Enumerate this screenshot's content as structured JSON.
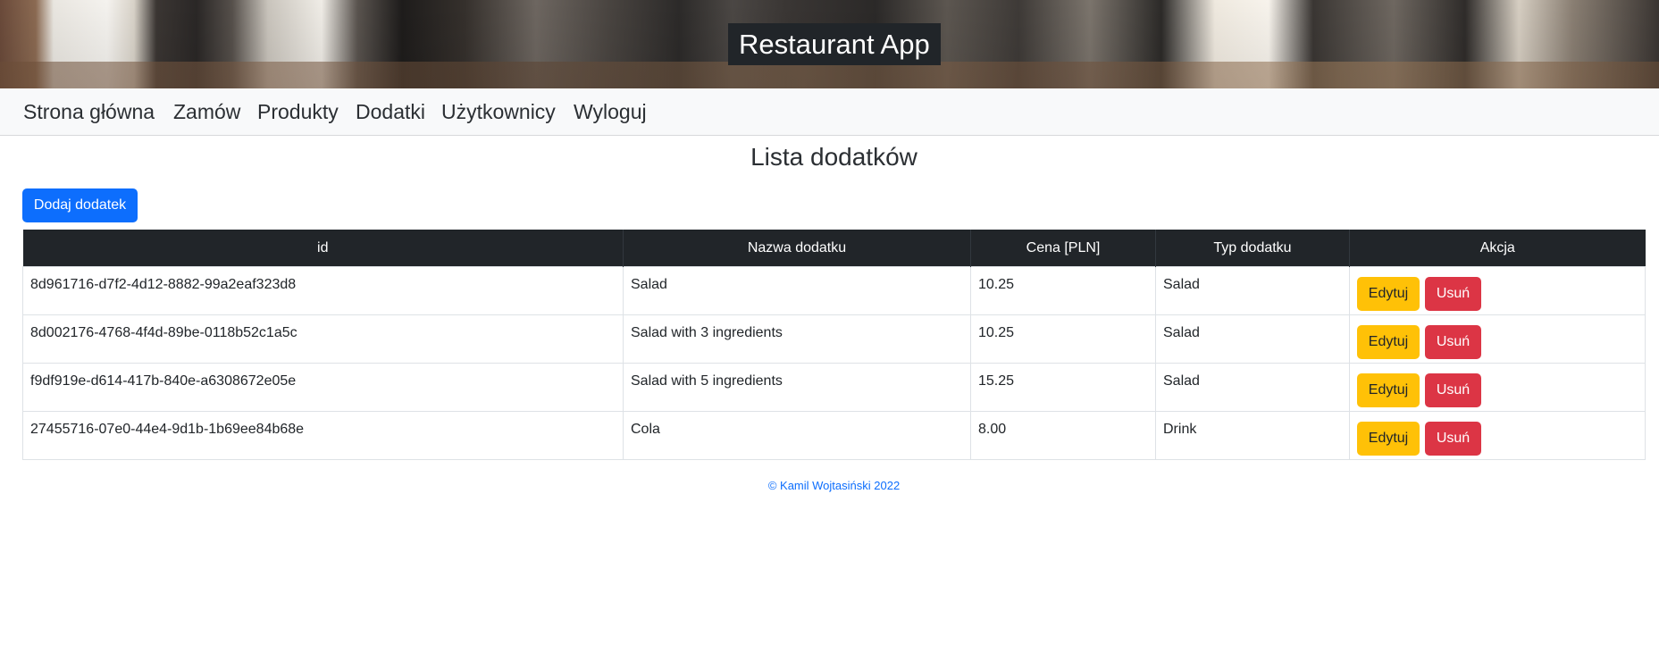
{
  "header": {
    "title": "Restaurant App"
  },
  "nav": {
    "items": [
      "Strona główna",
      "Zamów",
      "Produkty",
      "Dodatki",
      "Użytkownicy",
      "Wyloguj"
    ]
  },
  "main": {
    "title": "Lista dodatków",
    "add_button": "Dodaj dodatek",
    "table": {
      "headers": [
        "id",
        "Nazwa dodatku",
        "Cena [PLN]",
        "Typ dodatku",
        "Akcja"
      ],
      "rows": [
        {
          "id": "8d961716-d7f2-4d12-8882-99a2eaf323d8",
          "name": "Salad",
          "price": "10.25",
          "type": "Salad"
        },
        {
          "id": "8d002176-4768-4f4d-89be-0118b52c1a5c",
          "name": "Salad with 3 ingredients",
          "price": "10.25",
          "type": "Salad"
        },
        {
          "id": "f9df919e-d614-417b-840e-a6308672e05e",
          "name": "Salad with 5 ingredients",
          "price": "15.25",
          "type": "Salad"
        },
        {
          "id": "27455716-07e0-44e4-9d1b-1b69ee84b68e",
          "name": "Cola",
          "price": "8.00",
          "type": "Drink"
        }
      ],
      "edit_label": "Edytuj",
      "delete_label": "Usuń"
    }
  },
  "footer": {
    "text": "© Kamil Wojtasiński 2022"
  },
  "colors": {
    "primary": "#0d6efd",
    "warning": "#ffc107",
    "danger": "#dc3545",
    "dark": "#212529",
    "navbar_bg": "#f8f9fa"
  }
}
